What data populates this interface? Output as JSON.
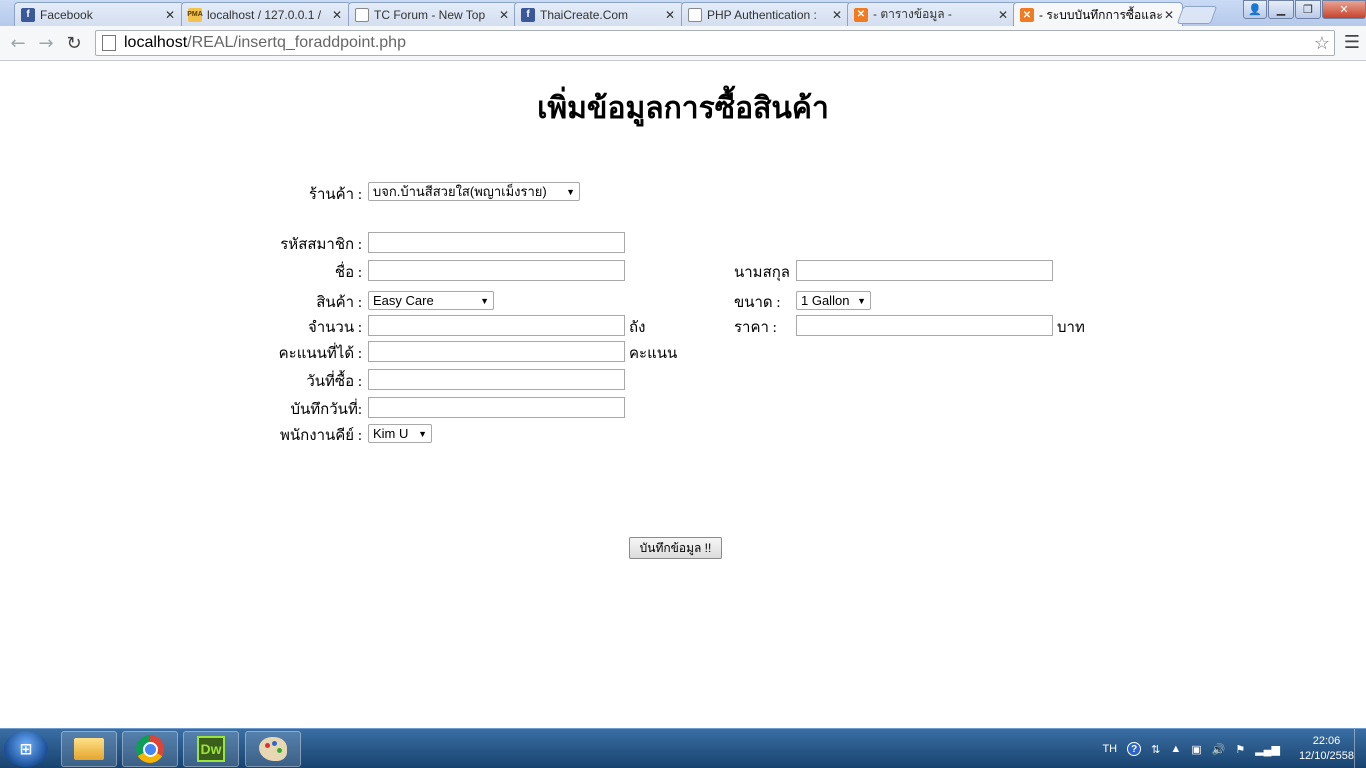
{
  "browser": {
    "tabs": [
      {
        "title": "Facebook",
        "favicon": "facebook-icon"
      },
      {
        "title": "localhost / 127.0.0.1 / ",
        "favicon": "phpmyadmin-icon"
      },
      {
        "title": "TC Forum - New Top",
        "favicon": "document-icon"
      },
      {
        "title": "ThaiCreate.Com",
        "favicon": "facebook-icon"
      },
      {
        "title": "PHP Authentication :",
        "favicon": "document-icon"
      },
      {
        "title": "- ตารางข้อมูล -",
        "favicon": "xampp-icon"
      },
      {
        "title": "- ระบบบันทึกการซื้อและ",
        "favicon": "xampp-icon"
      }
    ],
    "active_tab": 6,
    "close_glyph": "✕",
    "address": {
      "host": "localhost",
      "path": "/REAL/insertq_foraddpoint.php"
    }
  },
  "form": {
    "title": "เพิ่มข้อมูลการซื้อสินค้า",
    "shop_label": "ร้านค้า :",
    "shop_value": "บจก.บ้านสีสวยใส(พญาเม็งราย)",
    "member_id_label": "รหัสสมาชิก :",
    "member_id_value": "",
    "name_label": "ชื่อ :",
    "name_value": "",
    "surname_label": "นามสกุล",
    "surname_value": "",
    "product_label": "สินค้า :",
    "product_value": "Easy Care",
    "size_label": "ขนาด :",
    "size_value": "1 Gallon",
    "quantity_label": "จำนวน :",
    "quantity_value": "",
    "quantity_unit": "ถัง",
    "price_label": "ราคา :",
    "price_value": "",
    "price_unit": "บาท",
    "points_label": "คะแนนที่ได้ :",
    "points_value": "",
    "points_unit": "คะแนน",
    "purchase_date_label": "วันที่ซื้อ :",
    "purchase_date_value": "",
    "record_date_label": "บันทึกวันที่:",
    "record_date_value": "",
    "staff_label": "พนักงานคีย์ :",
    "staff_value": "Kim U",
    "submit_label": "บันทึกข้อมูล !!"
  },
  "taskbar": {
    "start_glyph": "⊞",
    "apps": [
      "file-explorer-icon",
      "chrome-icon",
      "dreamweaver-icon",
      "paint-icon"
    ],
    "dreamweaver_label": "Dw",
    "language": "TH",
    "time": "22:06",
    "date": "12/10/2558"
  }
}
